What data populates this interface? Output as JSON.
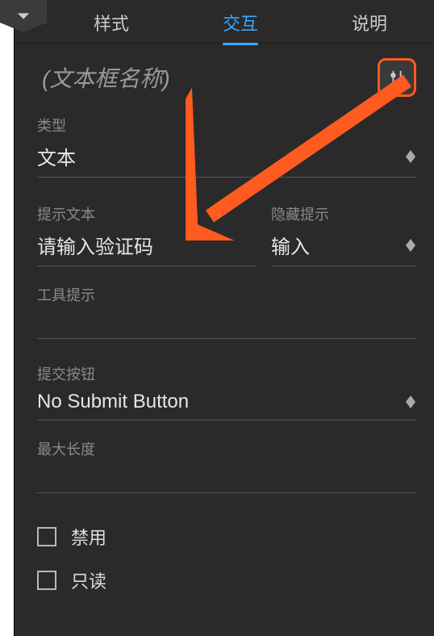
{
  "tabs": {
    "style": "样式",
    "interaction": "交互",
    "notes": "说明"
  },
  "title": "(文本框名称)",
  "labels": {
    "type": "类型",
    "hintText": "提示文本",
    "hideHint": "隐藏提示",
    "tooltip": "工具提示",
    "submit": "提交按钮",
    "maxLen": "最大长度"
  },
  "values": {
    "type": "文本",
    "hintText": "请输入验证码",
    "hideHint": "输入",
    "tooltip": "",
    "submit": "No Submit Button",
    "maxLen": ""
  },
  "check": {
    "disabled": "禁用",
    "readonly": "只读"
  },
  "colors": {
    "accent": "#3aa6ff",
    "highlight": "#ff5a1f"
  }
}
